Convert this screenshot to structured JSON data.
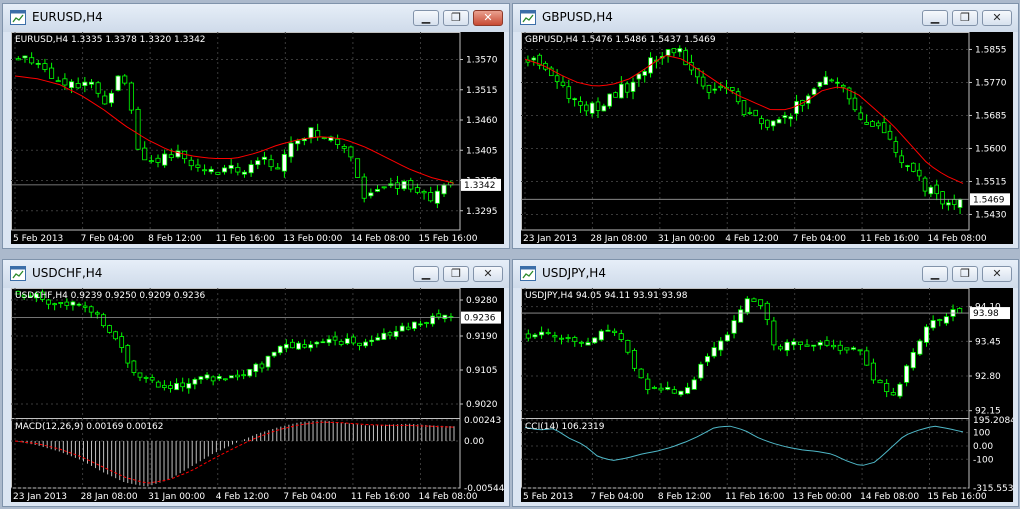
{
  "colors": {
    "background": "#000000",
    "grid": "#3a3a3a",
    "axis": "#c0c0c0",
    "bull_candle": "#ffffff",
    "bear_candle": "#000000",
    "candle_stroke": "#00ff00",
    "moving_average": "#ff0000",
    "price_tag_bg": "#ffffff",
    "macd_histogram": "#c0c0c0",
    "macd_signal": "#ff0000",
    "cci_line": "#4fb8c8"
  },
  "icons": {
    "window": "chart-window-icon",
    "minimize": "minimize-icon",
    "restore": "restore-icon",
    "close": "close-icon"
  },
  "windows": [
    {
      "title": "EURUSD,H4",
      "close_active": true,
      "ohlc_label": "EURUSD,H4  1.3335 1.3378 1.3320 1.3342",
      "current_price": 1.3342,
      "current_price_label": "1.3342",
      "price_axis": {
        "min": 1.326,
        "max": 1.362,
        "ticks": [
          "1.3570",
          "1.3515",
          "1.3460",
          "1.3405",
          "1.3350",
          "1.3295"
        ]
      },
      "time_labels": [
        "5 Feb 2013",
        "7 Feb 04:00",
        "8 Feb 12:00",
        "11 Feb 16:00",
        "13 Feb 00:00",
        "14 Feb 08:00",
        "15 Feb 16:00"
      ],
      "series": {
        "anchors": [
          1.3574,
          1.357,
          1.354,
          1.352,
          1.3535,
          1.349,
          1.356,
          1.34,
          1.3385,
          1.34,
          1.338,
          1.3365,
          1.3372,
          1.3365,
          1.3395,
          1.337,
          1.3425,
          1.344,
          1.343,
          1.3405,
          1.3315,
          1.3335,
          1.3345,
          1.333,
          1.332,
          1.3342
        ],
        "ma_anchors": [
          1.354,
          1.3535,
          1.3525,
          1.3505,
          1.348,
          1.345,
          1.3425,
          1.3405,
          1.3395,
          1.339,
          1.339,
          1.34,
          1.3415,
          1.3425,
          1.343,
          1.3425,
          1.341,
          1.339,
          1.337,
          1.3355,
          1.3345
        ],
        "count": 66,
        "noise": 0.0018,
        "seed": 11
      }
    },
    {
      "title": "GBPUSD,H4",
      "close_active": false,
      "ohlc_label": "GBPUSD,H4  1.5476 1.5486 1.5437 1.5469",
      "current_price": 1.5469,
      "current_price_label": "1.5469",
      "price_axis": {
        "min": 1.539,
        "max": 1.59,
        "ticks": [
          "1.5855",
          "1.5770",
          "1.5685",
          "1.5600",
          "1.5515",
          "1.5430"
        ]
      },
      "time_labels": [
        "23 Jan 2013",
        "28 Jan 08:00",
        "31 Jan 00:00",
        "4 Feb 12:00",
        "7 Feb 04:00",
        "11 Feb 16:00",
        "14 Feb 08:00"
      ],
      "series": {
        "anchors": [
          1.583,
          1.582,
          1.576,
          1.572,
          1.57,
          1.574,
          1.576,
          1.58,
          1.585,
          1.586,
          1.579,
          1.574,
          1.576,
          1.57,
          1.566,
          1.566,
          1.57,
          1.574,
          1.58,
          1.576,
          1.568,
          1.565,
          1.56,
          1.554,
          1.55,
          1.547,
          1.5469
        ],
        "ma_anchors": [
          1.583,
          1.5815,
          1.579,
          1.577,
          1.576,
          1.5765,
          1.578,
          1.581,
          1.584,
          1.583,
          1.58,
          1.577,
          1.574,
          1.572,
          1.57,
          1.57,
          1.572,
          1.575,
          1.576,
          1.574,
          1.57,
          1.566,
          1.561,
          1.556,
          1.553,
          1.551
        ],
        "count": 75,
        "noise": 0.003,
        "seed": 23
      }
    },
    {
      "title": "USDCHF,H4",
      "close_active": false,
      "ohlc_label": "USDCHF,H4  0.9239 0.9250 0.9209 0.9236",
      "current_price": 0.9236,
      "current_price_label": "0.9236",
      "price_axis": {
        "min": 0.899,
        "max": 0.931,
        "ticks": [
          "0.9280",
          "0.9190",
          "0.9105",
          "0.9020"
        ]
      },
      "time_labels": [
        "23 Jan 2013",
        "28 Jan 08:00",
        "31 Jan 00:00",
        "4 Feb 12:00",
        "7 Feb 04:00",
        "11 Feb 16:00",
        "14 Feb 08:00"
      ],
      "series": {
        "anchors": [
          0.93,
          0.929,
          0.927,
          0.928,
          0.925,
          0.92,
          0.911,
          0.908,
          0.906,
          0.907,
          0.909,
          0.908,
          0.91,
          0.912,
          0.916,
          0.917,
          0.917,
          0.918,
          0.917,
          0.919,
          0.92,
          0.922,
          0.923,
          0.9236
        ],
        "count": 72,
        "noise": 0.002,
        "seed": 37
      },
      "sub": {
        "label": "MACD(12,26,9) 0.00169 0.00162",
        "ticks": [
          "0.00243",
          "0.00",
          "-0.00544"
        ],
        "min": -0.00544,
        "max": 0.00243,
        "hist_anchors": [
          0.0,
          -0.0005,
          -0.0012,
          -0.0022,
          -0.0036,
          -0.0048,
          -0.0053,
          -0.0045,
          -0.003,
          -0.0015,
          -0.0003,
          0.0008,
          0.0016,
          0.0022,
          0.0024,
          0.0021,
          0.0018,
          0.0019,
          0.002,
          0.0018,
          0.0017
        ],
        "signal_anchors": [
          0.0,
          -0.0003,
          -0.0009,
          -0.0018,
          -0.003,
          -0.0042,
          -0.0049,
          -0.0045,
          -0.0035,
          -0.0021,
          -0.0008,
          0.0004,
          0.0013,
          0.0019,
          0.0022,
          0.0021,
          0.0019,
          0.0018,
          0.0018,
          0.0017,
          0.0016
        ]
      }
    },
    {
      "title": "USDJPY,H4",
      "close_active": false,
      "ohlc_label": "USDJPY,H4  94.05 94.11 93.91 93.98",
      "current_price": 93.98,
      "current_price_label": "93.98",
      "price_axis": {
        "min": 92.05,
        "max": 94.45,
        "ticks": [
          "94.10",
          "93.45",
          "92.80",
          "92.15"
        ]
      },
      "time_labels": [
        "5 Feb 2013",
        "7 Feb 04:00",
        "8 Feb 12:00",
        "11 Feb 16:00",
        "13 Feb 00:00",
        "14 Feb 08:00",
        "15 Feb 16:00"
      ],
      "series": {
        "anchors": [
          93.55,
          93.65,
          93.45,
          93.4,
          93.5,
          93.7,
          93.3,
          92.6,
          92.5,
          92.55,
          92.7,
          93.3,
          93.5,
          94.2,
          94.1,
          93.3,
          93.45,
          93.3,
          93.4,
          93.35,
          93.2,
          92.7,
          92.4,
          93.2,
          93.75,
          93.95,
          93.98
        ],
        "count": 66,
        "noise": 0.16,
        "seed": 51
      },
      "sub": {
        "label": "CCI(14) 106.2319",
        "ticks": [
          "195.2084",
          "100",
          "0.00",
          "-100",
          "-315.553"
        ],
        "min": -315.553,
        "max": 195.2084,
        "line_anchors": [
          140,
          120,
          130,
          60,
          10,
          -80,
          -110,
          -90,
          -60,
          -40,
          -10,
          30,
          80,
          140,
          150,
          120,
          60,
          20,
          -10,
          -30,
          -40,
          -60,
          -110,
          -150,
          -120,
          -20,
          80,
          120,
          150,
          130,
          106
        ]
      }
    }
  ]
}
